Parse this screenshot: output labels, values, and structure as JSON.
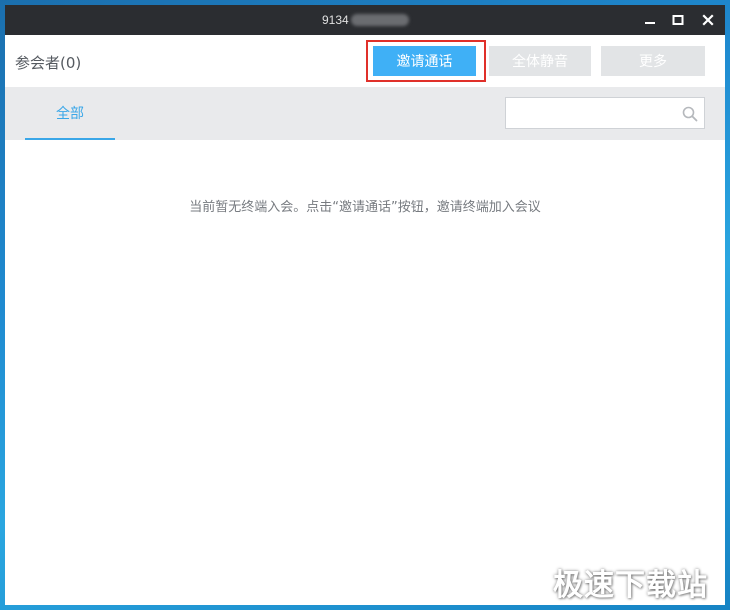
{
  "window": {
    "title": "9134"
  },
  "toolbar": {
    "participants_label": "参会者(0)",
    "invite_label": "邀请通话",
    "mute_all_label": "全体静音",
    "more_label": "更多"
  },
  "tabs": {
    "all_label": "全部"
  },
  "search": {
    "placeholder": "",
    "value": ""
  },
  "content": {
    "empty_message": "当前暂无终端入会。点击“邀请通话”按钮，邀请终端加入会议"
  },
  "watermark": {
    "text": "极速下载站"
  },
  "colors": {
    "titlebar": "#2b2d31",
    "accent": "#3fb0f6",
    "tab_active": "#3aa7e8",
    "highlight_border": "#e0302a",
    "disabled_button": "#e2e4e6"
  },
  "icons": {
    "minimize": "minimize-icon",
    "maximize": "maximize-icon",
    "close": "close-icon",
    "search": "search-icon"
  }
}
